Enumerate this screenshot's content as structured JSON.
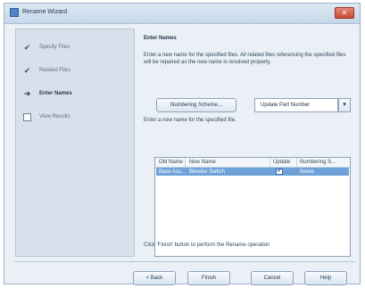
{
  "window": {
    "title": "Rename Wizard",
    "close_glyph": "✕"
  },
  "steps": [
    {
      "label": "Specify Files",
      "state": "done"
    },
    {
      "label": "Related Files",
      "state": "done"
    },
    {
      "label": "Enter Names",
      "state": "current"
    },
    {
      "label": "View Results",
      "state": "pending"
    }
  ],
  "main": {
    "heading": "Enter Names",
    "description": "Enter a new name for the specified files. All related files referencing the specified files will be repaired as the new name is resolved properly.",
    "numbering_button": "Numbering Scheme...",
    "dropdown_value": "Update Part Number",
    "prompt": "Enter a new name for the specified file.",
    "grid": {
      "columns": [
        "Old Name",
        "New Name",
        "Update",
        "Numbering S..."
      ],
      "rows": [
        {
          "old_name": "Base Ass...",
          "new_name": "Blender Switch",
          "update": true,
          "numbering": "Name"
        }
      ]
    },
    "finish_note": "Click 'Finish' button to perform the Rename operation"
  },
  "footer": {
    "back": "< Back",
    "finish": "Finish",
    "cancel": "Cancel",
    "help": "Help"
  },
  "icons": {
    "done": "check-icon",
    "current": "arrow-right-icon",
    "pending": "checkbox-empty-icon"
  },
  "colors": {
    "selection": "#6fa2d8",
    "window_bg": "#eaf0f6",
    "close_red": "#c9482f"
  }
}
